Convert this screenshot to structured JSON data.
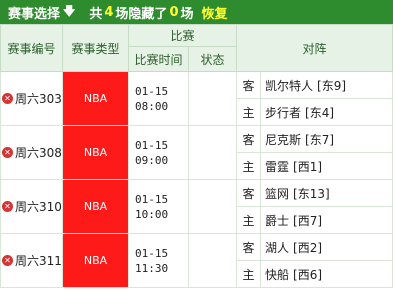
{
  "topbar": {
    "select_label": "赛事选择",
    "arrow_icon": "arrow-down-icon",
    "total_prefix": "共",
    "match_count": "4",
    "mid_text": "场隐藏了",
    "hidden_count": "0",
    "suffix": "场",
    "restore_label": "恢复"
  },
  "header": {
    "col_id": "赛事编号",
    "col_type": "赛事类型",
    "col_match": "比赛",
    "col_time": "比赛时间",
    "col_status": "状态",
    "col_teams": "对阵"
  },
  "matches": [
    {
      "id": "周六303",
      "type": "NBA",
      "date": "01-15",
      "time": "08:00",
      "status": "",
      "away_label": "客",
      "away": "凯尔特人",
      "away_rank": "[东9]",
      "home_label": "主",
      "home": "步行者",
      "home_rank": "[东4]"
    },
    {
      "id": "周六308",
      "type": "NBA",
      "date": "01-15",
      "time": "09:00",
      "status": "",
      "away_label": "客",
      "away": "尼克斯",
      "away_rank": "[东7]",
      "home_label": "主",
      "home": "雷霆",
      "home_rank": "[西1]"
    },
    {
      "id": "周六310",
      "type": "NBA",
      "date": "01-15",
      "time": "10:00",
      "status": "",
      "away_label": "客",
      "away": "篮网",
      "away_rank": "[东13]",
      "home_label": "主",
      "home": "爵士",
      "home_rank": "[西7]"
    },
    {
      "id": "周六311",
      "type": "NBA",
      "date": "01-15",
      "time": "11:30",
      "status": "",
      "away_label": "客",
      "away": "湖人",
      "away_rank": "[西2]",
      "home_label": "主",
      "home": "快船",
      "home_rank": "[西6]"
    }
  ],
  "colors": {
    "topbar": "#2e8b2e",
    "highlight": "#ffff33",
    "type_bg": "#ff1a1a",
    "header_bg": "#e6f2e6"
  }
}
